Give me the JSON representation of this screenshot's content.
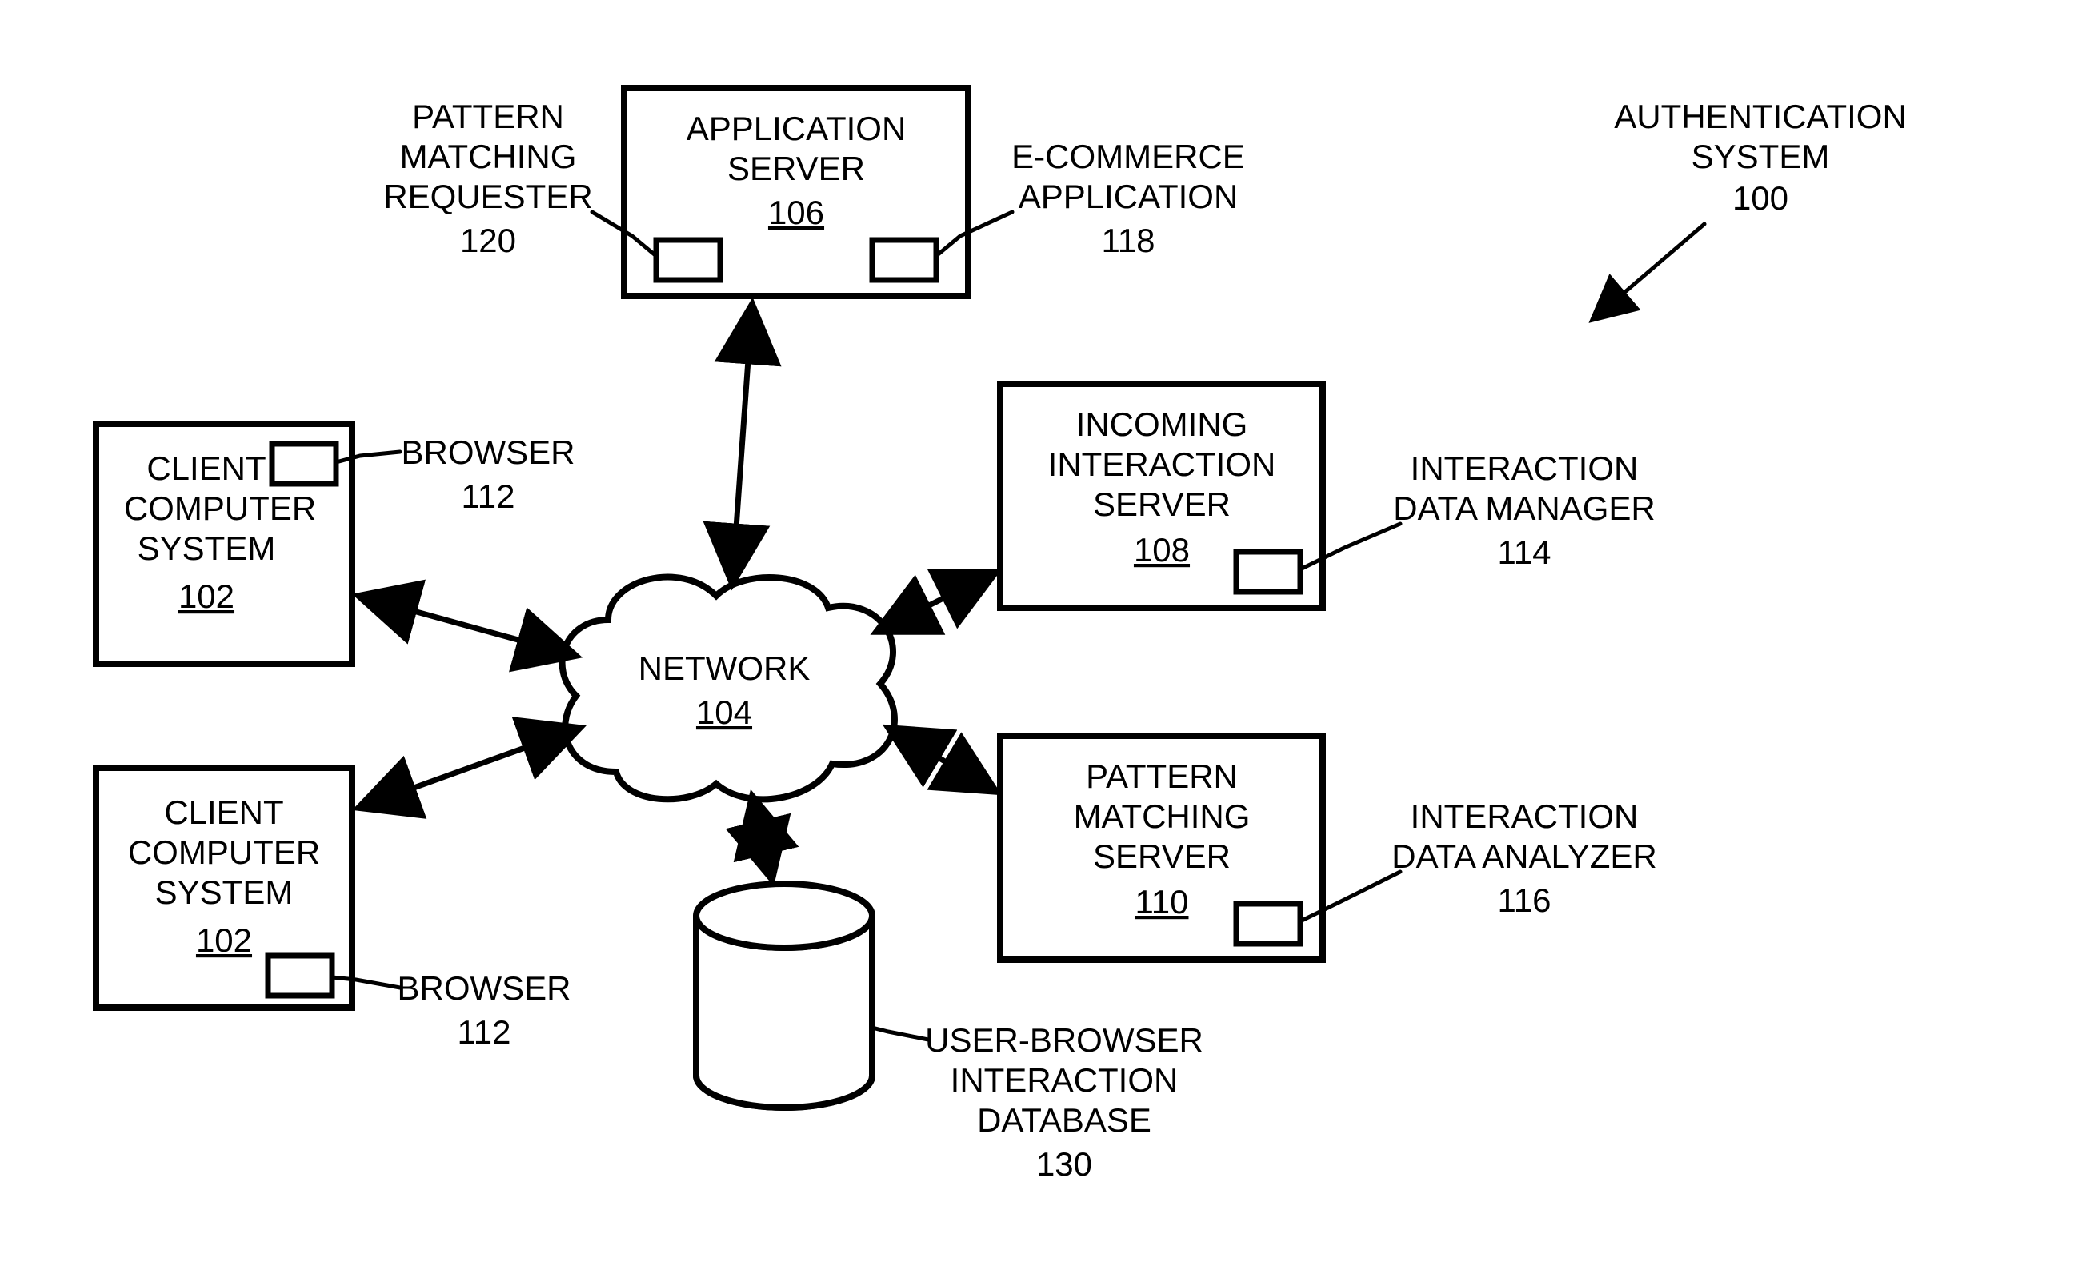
{
  "title": {
    "line1": "AUTHENTICATION",
    "line2": "SYSTEM",
    "num": "100"
  },
  "nodes": {
    "client1": {
      "line1": "CLIENT",
      "line2": "COMPUTER",
      "line3": "SYSTEM",
      "num": "102"
    },
    "client2": {
      "line1": "CLIENT",
      "line2": "COMPUTER",
      "line3": "SYSTEM",
      "num": "102"
    },
    "app_server": {
      "line1": "APPLICATION",
      "line2": "SERVER",
      "num": "106"
    },
    "incoming": {
      "line1": "INCOMING",
      "line2": "INTERACTION",
      "line3": "SERVER",
      "num": "108"
    },
    "pattern": {
      "line1": "PATTERN",
      "line2": "MATCHING",
      "line3": "SERVER",
      "num": "110"
    },
    "network": {
      "label": "NETWORK",
      "num": "104"
    },
    "database": {
      "line1": "USER-BROWSER",
      "line2": "INTERACTION",
      "line3": "DATABASE",
      "num": "130"
    }
  },
  "callouts": {
    "browser1": {
      "label": "BROWSER",
      "num": "112"
    },
    "browser2": {
      "label": "BROWSER",
      "num": "112"
    },
    "pmr": {
      "line1": "PATTERN",
      "line2": "MATCHING",
      "line3": "REQUESTER",
      "num": "120"
    },
    "ecom": {
      "line1": "E-COMMERCE",
      "line2": "APPLICATION",
      "num": "118"
    },
    "idm": {
      "line1": "INTERACTION",
      "line2": "DATA MANAGER",
      "num": "114"
    },
    "ida": {
      "line1": "INTERACTION",
      "line2": "DATA ANALYZER",
      "num": "116"
    }
  }
}
